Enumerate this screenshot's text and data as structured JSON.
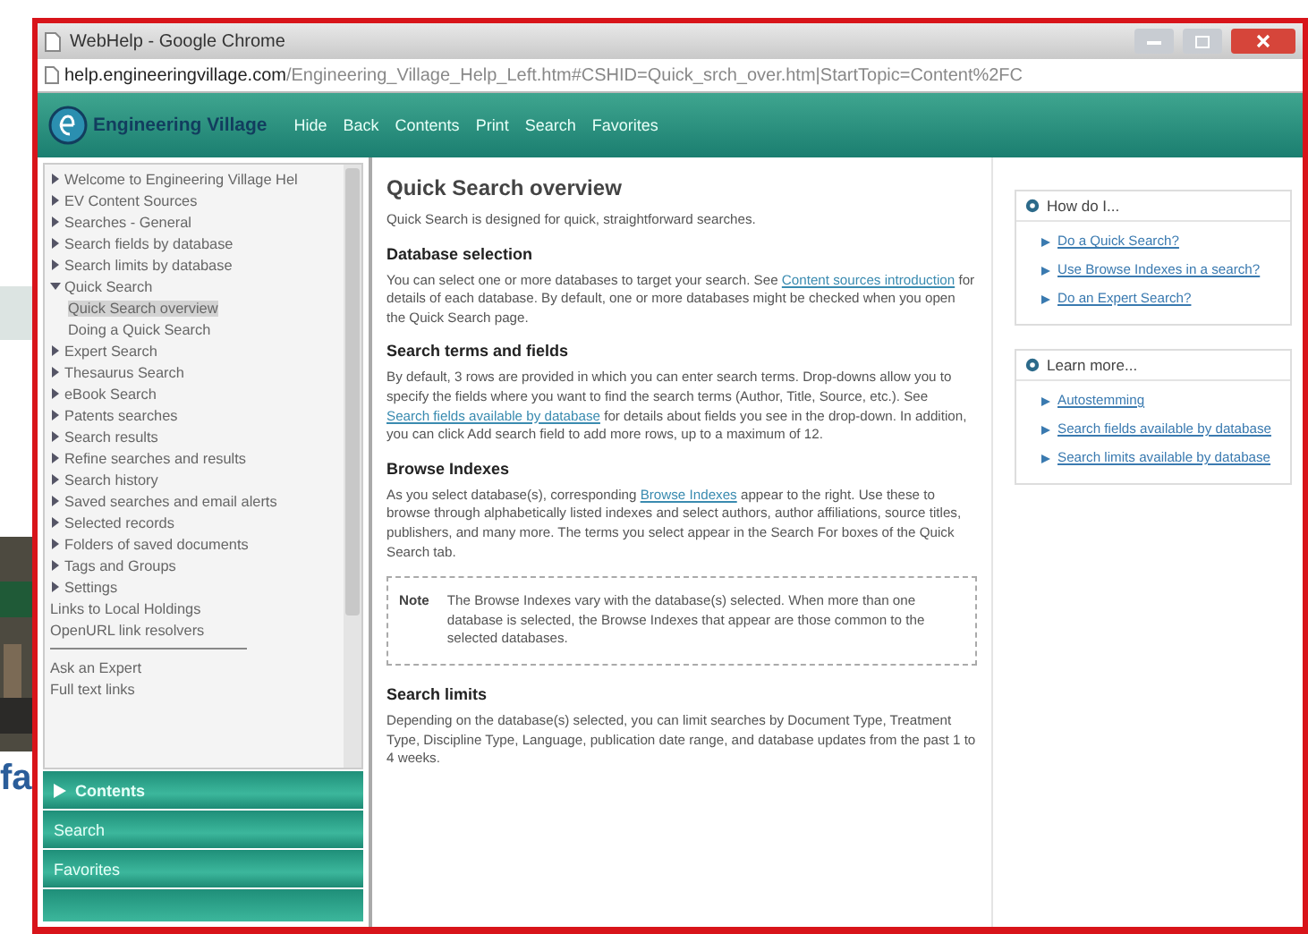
{
  "background": {
    "text": "fa"
  },
  "window": {
    "title": "WebHelp - Google Chrome"
  },
  "address_bar": {
    "host": "help.engineeringvillage.com",
    "path": "/Engineering_Village_Help_Left.htm#CSHID=Quick_srch_over.htm|StartTopic=Content%2FC"
  },
  "toolbar": {
    "logo": "Engineering Village",
    "items": [
      "Hide",
      "Back",
      "Contents",
      "Print",
      "Search",
      "Favorites"
    ]
  },
  "tree": [
    {
      "label": "Welcome to Engineering Village Hel",
      "expanded": false
    },
    {
      "label": "EV Content Sources",
      "expanded": false
    },
    {
      "label": "Searches - General",
      "expanded": false
    },
    {
      "label": "Search fields by database",
      "expanded": false
    },
    {
      "label": "Search limits by database",
      "expanded": false
    },
    {
      "label": "Quick Search",
      "expanded": true,
      "children": [
        {
          "label": "Quick Search overview",
          "selected": true
        },
        {
          "label": "Doing a Quick Search",
          "selected": false
        }
      ]
    },
    {
      "label": "Expert Search",
      "expanded": false
    },
    {
      "label": "Thesaurus Search",
      "expanded": false
    },
    {
      "label": "eBook Search",
      "expanded": false
    },
    {
      "label": "Patents searches",
      "expanded": false
    },
    {
      "label": "Search results",
      "expanded": false
    },
    {
      "label": "Refine searches and results",
      "expanded": false
    },
    {
      "label": "Search history",
      "expanded": false
    },
    {
      "label": "Saved searches and email alerts",
      "expanded": false
    },
    {
      "label": "Selected records",
      "expanded": false
    },
    {
      "label": "Folders of saved documents",
      "expanded": false
    },
    {
      "label": "Tags and Groups",
      "expanded": false
    },
    {
      "label": "Settings",
      "expanded": false
    }
  ],
  "extra_links": [
    [
      "Links to Local Holdings",
      "OpenURL link resolvers"
    ],
    [
      "Ask an Expert",
      "Full text links"
    ]
  ],
  "panes": [
    {
      "label": "Contents",
      "selected": true
    },
    {
      "label": "Search",
      "selected": false
    },
    {
      "label": "Favorites",
      "selected": false
    }
  ],
  "article": {
    "title": "Quick Search overview",
    "sections": [
      {
        "kind": "para",
        "parts": [
          {
            "kind": "text",
            "text": "Quick Search is designed for quick, straightforward searches."
          }
        ]
      },
      {
        "kind": "heading",
        "text": "Database selection"
      },
      {
        "kind": "para",
        "parts": [
          {
            "kind": "text",
            "text": "You can select one or more databases to target your search. See "
          },
          {
            "kind": "link",
            "text": "Content sources introduction"
          },
          {
            "kind": "text",
            "text": " for details of each database. By default, one or more databases might be checked when you open the Quick Search page."
          }
        ]
      },
      {
        "kind": "heading",
        "text": "Search terms and fields"
      },
      {
        "kind": "para",
        "parts": [
          {
            "kind": "text",
            "text": "By default, 3 rows are provided in which you can enter search terms. Drop-downs allow you to specify the fields where you want to find the search terms (Author, Title, Source, etc.). See "
          },
          {
            "kind": "link",
            "text": "Search fields available by database"
          },
          {
            "kind": "text",
            "text": " for details about fields you see in the drop-down. In addition, you can click Add search field to add more rows, up to a maximum of 12."
          }
        ]
      },
      {
        "kind": "heading",
        "text": "Browse Indexes"
      },
      {
        "kind": "para",
        "parts": [
          {
            "kind": "text",
            "text": "As you select database(s), corresponding "
          },
          {
            "kind": "link",
            "text": "Browse Indexes"
          },
          {
            "kind": "text",
            "text": " appear to the right. Use these to browse through alphabetically listed indexes and select authors, author affiliations, source titles, publishers, and many more. The terms you select appear in the Search For boxes of the Quick Search tab."
          }
        ]
      },
      {
        "kind": "note",
        "label": "Note",
        "text": "The Browse Indexes vary with the database(s) selected. When more than one database is selected, the Browse Indexes that appear are those common to the selected databases."
      },
      {
        "kind": "heading",
        "text": "Search limits"
      },
      {
        "kind": "para",
        "parts": [
          {
            "kind": "text",
            "text": "Depending on the database(s) selected, you can limit searches by Document Type, Treatment Type, Discipline Type, Language, publication date range, and database updates from the past 1 to 4 weeks."
          }
        ]
      }
    ]
  },
  "side_boxes": [
    {
      "title": "How do I...",
      "links": [
        "Do a Quick Search?",
        "Use Browse Indexes in a search?",
        "Do an Expert Search?"
      ]
    },
    {
      "title": "Learn more...",
      "links": [
        "Autostemming",
        "Search fields available by database",
        "Search limits available by database"
      ]
    }
  ]
}
